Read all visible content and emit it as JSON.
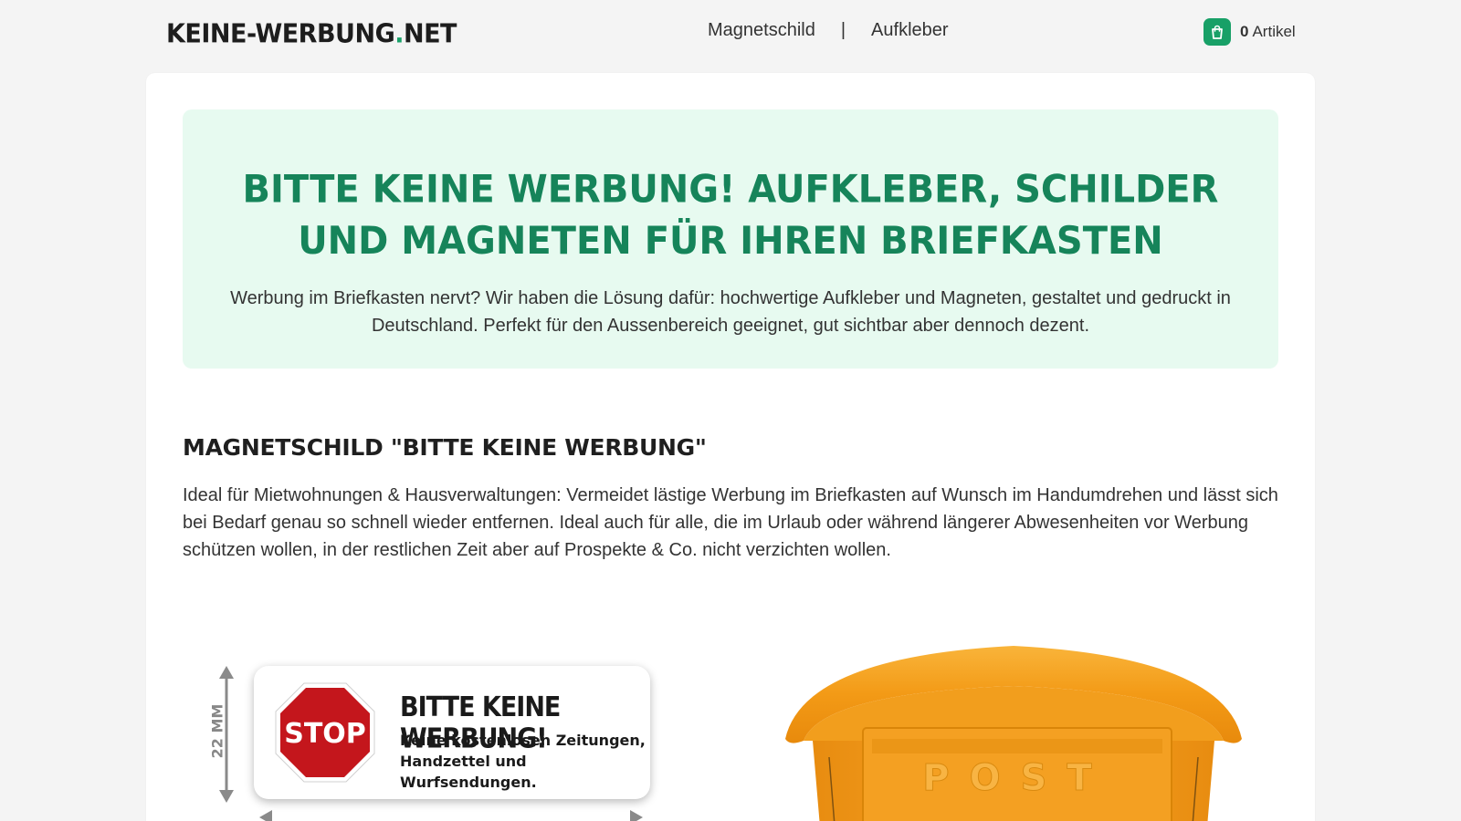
{
  "header": {
    "logo_main": "KEINE-WERBUNG",
    "logo_dot": ".",
    "logo_tld": "NET",
    "nav": [
      {
        "label": "Magnetschild"
      },
      {
        "label": "Aufkleber"
      }
    ],
    "nav_separator": "|",
    "cart": {
      "count": "0",
      "label": "Artikel",
      "icon": "shopping-bag-icon"
    }
  },
  "hero": {
    "title": "Bitte keine Werbung! Aufkleber, Schilder und Magneten für Ihren Briefkasten",
    "text": "Werbung im Briefkasten nervt? Wir haben die Lösung dafür: hochwertige Aufkleber und Magneten, gestaltet und gedruckt in Deutschland. Perfekt für den Aussenbereich geeignet, gut sichtbar aber dennoch dezent."
  },
  "product": {
    "title": "Magnetschild \"Bitte keine Werbung\"",
    "text": "Ideal für Mietwohnungen & Hausverwaltungen: Vermeidet lästige Werbung im Briefkasten auf Wunsch im Handumdrehen und lässt sich bei Bedarf genau so schnell wieder entfernen. Ideal auch für alle, die im Urlaub oder während längerer Abwesenheiten vor Werbung schützen wollen, in der restlichen Zeit aber auf Prospekte & Co. nicht verzichten wollen."
  },
  "sign_image": {
    "dimension_label": "22 MM",
    "stop_text": "STOP",
    "title": "BITTE KEINE WERBUNG!",
    "subtitle": "Keine kostenlosen Zeitungen, Handzettel und Wurfsendungen."
  },
  "mailbox_image": {
    "embossed_text": "POST"
  },
  "colors": {
    "accent": "#18a067",
    "hero_bg": "#e7faf0",
    "hero_title": "#16845a",
    "stop_red": "#c4161c",
    "mailbox_orange": "#f6a21e"
  }
}
